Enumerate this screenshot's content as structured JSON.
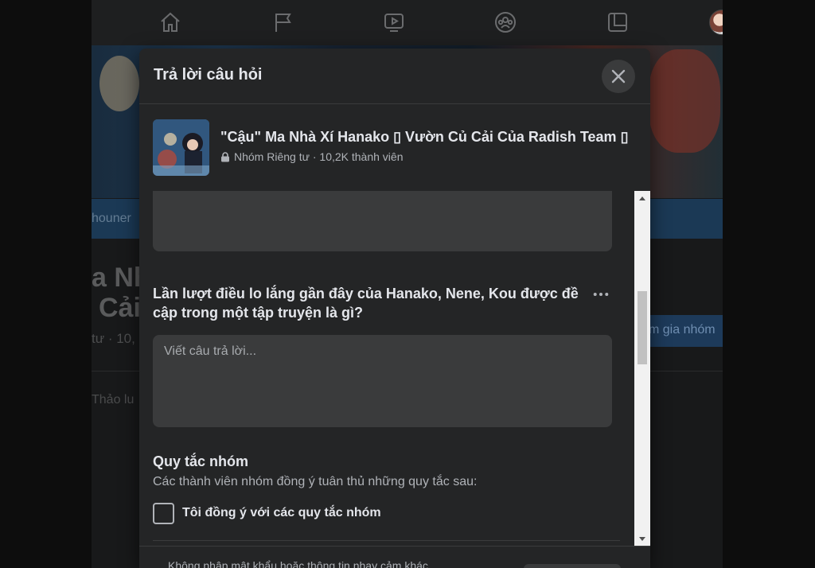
{
  "modal": {
    "title": "Trả lời câu hỏi",
    "group_name": "\"Cậu\" Ma Nhà Xí Hanako ▯ Vườn Củ Cải Của Radish Team ▯",
    "group_meta": "Nhóm Riêng tư · 10,2K thành viên",
    "question": "Lần lượt điều lo lắng gần đây của Hanako, Nene, Kou được đề cập trong một tập truyện là gì?",
    "more_label": "•••",
    "answer_placeholder": "Viết câu trả lời...",
    "rules_title": "Quy tắc nhóm",
    "rules_desc": "Các thành viên nhóm đồng ý tuân thủ những quy tắc sau:",
    "agree_label": "Tôi đồng ý với các quy tắc nhóm",
    "footer_text": "Không nhập mật khẩu hoặc thông tin nhạy cảm khác"
  },
  "background": {
    "tab_text": "houner",
    "title_lines": [
      "a Nh",
      "Cải"
    ],
    "sub_text": "tư · 10,",
    "join_text": "m gia nhóm",
    "tab_discussion": "Thảo lu"
  },
  "icons": {
    "nav": [
      "home-icon",
      "pages-flag-icon",
      "watch-icon",
      "groups-icon",
      "gaming-icon"
    ],
    "close": "close-icon",
    "lock": "lock-icon"
  },
  "colors": {
    "modal_bg": "#242526",
    "input_bg": "#3a3b3c",
    "text_primary": "#e4e6eb",
    "text_secondary": "#b0b3b8"
  }
}
